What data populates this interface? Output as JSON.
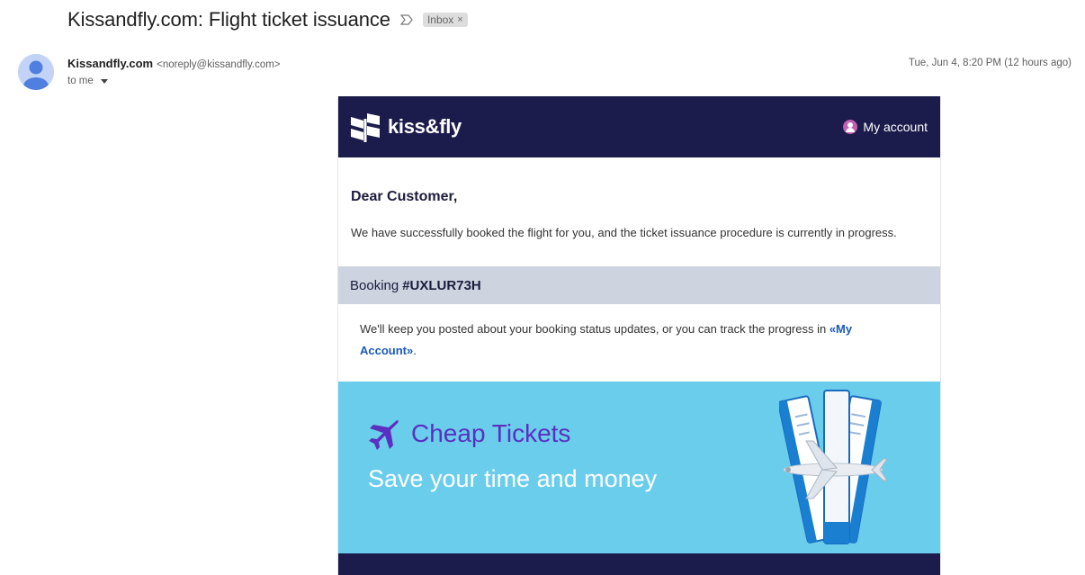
{
  "email": {
    "subject": "Kissandfly.com: Flight ticket issuance",
    "label": "Inbox",
    "label_close": "×",
    "sender_name": "Kissandfly.com",
    "sender_email": "<noreply@kissandfly.com>",
    "recipient": "to me",
    "date": "Tue, Jun 4, 8:20 PM (12 hours ago)"
  },
  "mail": {
    "brand": "kiss&fly",
    "account_link": "My account",
    "greeting": "Dear Customer,",
    "intro": "We have successfully booked the flight for you, and the ticket issuance procedure is currently in progress.",
    "booking_label": "Booking",
    "booking_id": "#UXLUR73H",
    "status_text": "We'll keep you posted about your booking status updates, or you can track the progress in ",
    "status_link": "«My Account»",
    "status_end": ".",
    "banner_title": "Cheap Tickets",
    "banner_subtitle": "Save your time and money"
  },
  "colors": {
    "header_bg": "#1c1c4c",
    "booking_bar_bg": "#cdd4e0",
    "banner_bg": "#6bcdec",
    "banner_title": "#5b2fbf",
    "link": "#1a5ab8"
  }
}
